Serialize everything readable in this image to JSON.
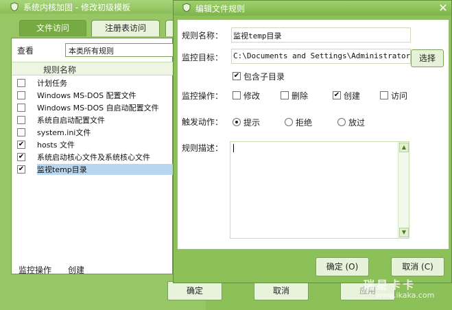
{
  "background_window": {
    "title": "系统内核加固 - 修改初级模板",
    "tabs": [
      "文件访问",
      "注册表访问"
    ],
    "view_label": "查看",
    "view_select": "本类所有规则",
    "list_header": "规则名称",
    "rows": [
      {
        "label": "计划任务",
        "checked": false
      },
      {
        "label": "Windows MS-DOS 配置文件",
        "checked": false
      },
      {
        "label": "Windows MS-DOS 自启动配置文件",
        "checked": false
      },
      {
        "label": "系统自启动配置文件",
        "checked": false
      },
      {
        "label": "system.ini文件",
        "checked": false
      },
      {
        "label": "hosts 文件",
        "checked": true
      },
      {
        "label": "系统启动核心文件及系统核心文件",
        "checked": true
      },
      {
        "label": "监视temp目录",
        "checked": true,
        "selected": true
      }
    ],
    "bottom_labels": [
      "监控操作",
      "创建"
    ],
    "buttons": [
      "确定",
      "取消",
      "应用"
    ]
  },
  "dialog": {
    "title": "编辑文件规则",
    "rule_name_label": "规则名称：",
    "rule_name_value": "监视temp目录",
    "monitor_target_label": "监控目标：",
    "monitor_target_value": "C:\\Documents and Settings\\Administrator\\Local",
    "choose_button": "选择",
    "include_subdir": {
      "label": "包含子目录",
      "checked": true
    },
    "monitor_ops_label": "监控操作：",
    "ops": [
      {
        "label": "修改",
        "checked": false
      },
      {
        "label": "删除",
        "checked": false
      },
      {
        "label": "创建",
        "checked": true
      },
      {
        "label": "访问",
        "checked": false
      }
    ],
    "trigger_label": "触发动作：",
    "actions": [
      {
        "label": "提示",
        "selected": true
      },
      {
        "label": "拒绝",
        "selected": false
      },
      {
        "label": "放过",
        "selected": false
      }
    ],
    "desc_label": "规则描述：",
    "ok_button": "确定 (O)",
    "cancel_button": "取消 (C)"
  },
  "watermark": {
    "text": "瑞星卡卡",
    "url": "www.ikaka.com"
  },
  "colors": {
    "theme_green": "#8cc058",
    "title_green": "#7db34a",
    "selection": "#b8d7ef"
  }
}
